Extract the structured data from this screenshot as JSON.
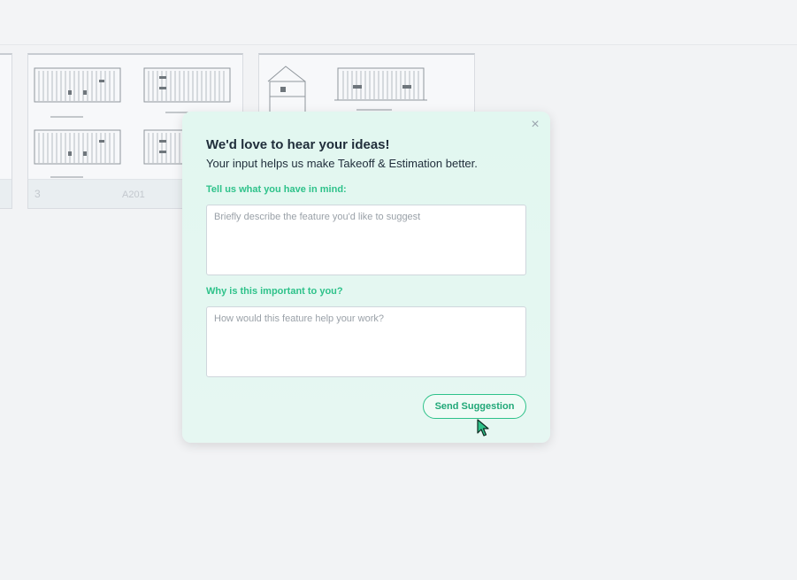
{
  "sheets": [
    {
      "number": "",
      "code": ""
    },
    {
      "number": "3",
      "code": "A201"
    },
    {
      "number": "",
      "code": ""
    }
  ],
  "feedback": {
    "close_label": "×",
    "title": "We'd love to hear your ideas!",
    "subtitle": "Your input helps us make Takeoff & Estimation better.",
    "idea_label": "Tell us what you have in mind:",
    "idea_placeholder": "Briefly describe the feature you'd like to suggest",
    "reason_label": "Why is this important to you?",
    "reason_placeholder": "How would this feature help your work?",
    "send_label": "Send Suggestion"
  },
  "colors": {
    "accent": "#2ec28a",
    "card_background": "#e2f7f0",
    "page_background": "#f2f3f5"
  }
}
